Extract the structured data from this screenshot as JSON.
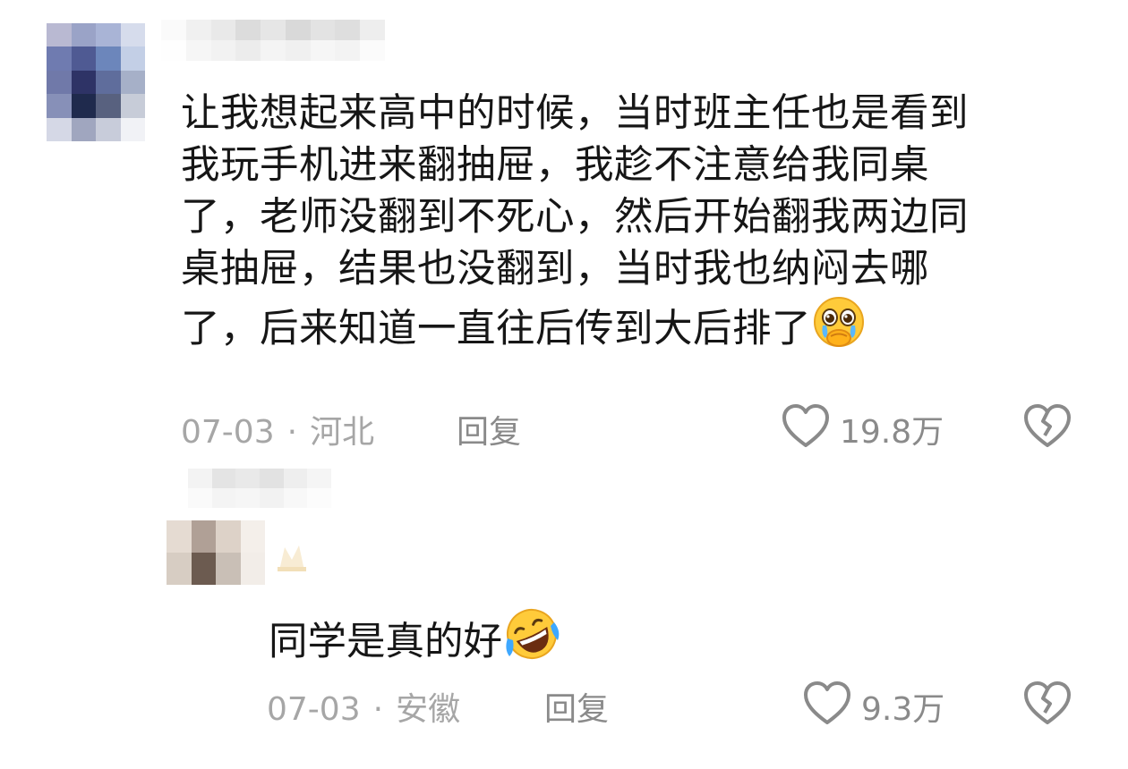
{
  "comments": [
    {
      "text_lines": [
        "让我想起来高中的时候，当时班主任也是看到",
        "我玩手机进来翻抽屉，我趁不注意给我同桌",
        "了，老师没翻到不死心，然后开始翻我两边同",
        "桌抽屉，结果也没翻到，当时我也纳闷去哪",
        "了，后来知道一直往后传到大后排了"
      ],
      "emoji": "pleading-tears-emoji",
      "date": "07-03",
      "separator": "·",
      "location": "河北",
      "reply_label": "回复",
      "like_count": "19.8万"
    },
    {
      "text": "同学是真的好",
      "emoji": "rofl-emoji",
      "date": "07-03",
      "separator": "·",
      "location": "安徽",
      "reply_label": "回复",
      "like_count": "9.3万"
    }
  ],
  "icons": {
    "like": "heart-outline-icon",
    "dislike": "broken-heart-outline-icon"
  },
  "colors": {
    "text": "#161616",
    "meta": "#a6a6a6",
    "icon": "#8a8a8a",
    "emoji_yellow": "#ffcc33"
  }
}
